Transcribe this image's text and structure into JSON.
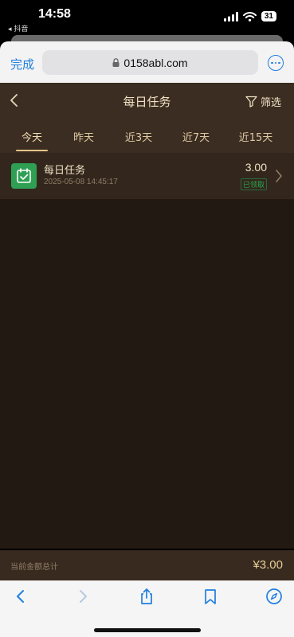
{
  "status_bar": {
    "time": "14:58",
    "back_app": "◂ 抖音",
    "battery": "31"
  },
  "browser": {
    "done_label": "完成",
    "url": "0158abl.com"
  },
  "header": {
    "title": "每日任务",
    "filter_label": "筛选"
  },
  "tabs": [
    {
      "label": "今天",
      "active": true
    },
    {
      "label": "昨天",
      "active": false
    },
    {
      "label": "近3天",
      "active": false
    },
    {
      "label": "近7天",
      "active": false
    },
    {
      "label": "近15天",
      "active": false
    }
  ],
  "records": [
    {
      "title": "每日任务",
      "time": "2025-05-08 14:45:17",
      "amount": "3.00",
      "status": "已领取",
      "icon": "calendar-check-icon"
    }
  ],
  "footer": {
    "label": "当前金额总计",
    "total": "¥3.00"
  },
  "colors": {
    "accent": "#1f7fe0",
    "header_bg": "#3b2d21",
    "page_bg": "#221912",
    "gold": "#e5c58b",
    "green": "#2f9f54"
  }
}
